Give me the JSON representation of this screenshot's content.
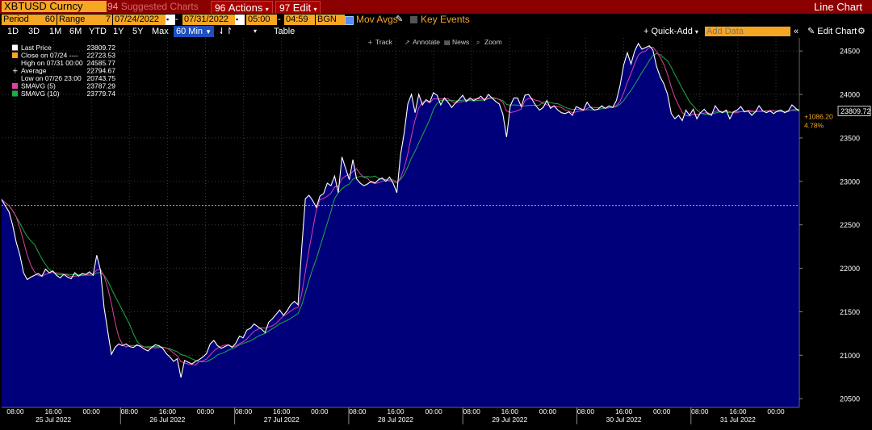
{
  "toolbar": {
    "ticker": "XBTUSD Curncy",
    "suggested_num": "94",
    "suggested": "Suggested Charts",
    "actions_num": "96",
    "actions": "Actions",
    "edit_num": "97",
    "edit": "Edit",
    "title": "Line Chart"
  },
  "settings": {
    "period_label": "Period",
    "period_value": "60",
    "range_label": "Range",
    "range_value": "7",
    "start_date": "07/24/2022",
    "end_date": "07/31/2022",
    "start_time": "05:00",
    "end_time": "04:59",
    "bgn": "BGN",
    "mov_avgs": "Mov Avgs",
    "key_events": "Key Events"
  },
  "ranges": {
    "items": [
      "1D",
      "3D",
      "1M",
      "6M",
      "YTD",
      "1Y",
      "5Y",
      "Max"
    ],
    "selected": "60 Min",
    "table": "Table",
    "quick_add": "Quick-Add",
    "add_data_placeholder": "Add Data",
    "edit_chart": "Edit Chart"
  },
  "tools": {
    "track": "Track",
    "annotate": "Annotate",
    "news": "News",
    "zoom": "Zoom"
  },
  "legend": [
    {
      "label": "Last Price",
      "value": "23809.72",
      "marker": "box",
      "color": "#ffffff"
    },
    {
      "label": "Close on 07/24 ----",
      "value": "22723.53",
      "marker": "box",
      "color": "#f5a623"
    },
    {
      "label": "High on 07/31 00:00",
      "value": "24585.77",
      "marker": "none",
      "color": ""
    },
    {
      "label": "Average",
      "value": "22794.67",
      "marker": "plus",
      "color": "#ffffff"
    },
    {
      "label": "Low on 07/26 23:00",
      "value": "20743.75",
      "marker": "none",
      "color": ""
    },
    {
      "label": "SMAVG (5)",
      "value": "23787.29",
      "marker": "box",
      "color": "#e040a0"
    },
    {
      "label": "SMAVG (10)",
      "value": "23779.74",
      "marker": "box",
      "color": "#22aa44"
    }
  ],
  "right_labels": {
    "last": "23809.72",
    "change": "+1086.20",
    "change_pct": "4.78%"
  },
  "colors": {
    "price": "#ffffff",
    "fill": "#00007a",
    "sma5": "#e040a0",
    "sma10": "#22aa44",
    "reference": "#f5a623",
    "accent": "#f5a623",
    "bar_red": "#8b0000"
  },
  "chart_data": {
    "type": "area",
    "title": "",
    "xlabel": "",
    "ylabel": "",
    "ylim": [
      20400,
      24650
    ],
    "y_ticks": [
      20500,
      21000,
      21500,
      22000,
      22500,
      23000,
      23500,
      24000,
      24500
    ],
    "x_tick_labels": [
      "08:00",
      "16:00",
      "00:00",
      "08:00",
      "16:00",
      "00:00",
      "08:00",
      "16:00",
      "00:00",
      "08:00",
      "16:00",
      "00:00",
      "08:00",
      "16:00",
      "00:00",
      "08:00",
      "16:00",
      "00:00",
      "08:00",
      "16:00",
      "00:00"
    ],
    "x_day_labels": [
      "25 Jul 2022",
      "26 Jul 2022",
      "27 Jul 2022",
      "28 Jul 2022",
      "29 Jul 2022",
      "30 Jul 2022",
      "31 Jul 2022"
    ],
    "reference_value": 22723.53,
    "grid": true,
    "legend_position": "top-left",
    "series": [
      {
        "name": "Last Price",
        "values": [
          22790,
          22720,
          22650,
          22500,
          22300,
          22150,
          21950,
          21870,
          21900,
          21920,
          21940,
          21910,
          21990,
          21950,
          21970,
          21920,
          21890,
          21930,
          21900,
          21880,
          21950,
          21910,
          21940,
          21930,
          21960,
          21920,
          22150,
          21980,
          21550,
          21280,
          21010,
          21090,
          21130,
          21110,
          21130,
          21100,
          21090,
          21120,
          21100,
          21070,
          21050,
          21090,
          21120,
          21110,
          21080,
          21020,
          20980,
          20930,
          20960,
          20744,
          20940,
          20920,
          20900,
          20930,
          20950,
          20980,
          21020,
          21130,
          21170,
          21110,
          21080,
          21100,
          21120,
          21090,
          21140,
          21220,
          21200,
          21290,
          21310,
          21360,
          21330,
          21300,
          21260,
          21380,
          21420,
          21470,
          21520,
          21460,
          21510,
          21580,
          21620,
          21580,
          22220,
          22800,
          22840,
          22780,
          22700,
          22830,
          22860,
          22980,
          22950,
          23060,
          22870,
          23280,
          23150,
          23020,
          23250,
          23030,
          22980,
          22950,
          22970,
          23000,
          22980,
          23020,
          23040,
          23000,
          23050,
          22980,
          22870,
          23300,
          23550,
          23890,
          24000,
          23790,
          24000,
          23880,
          23940,
          23910,
          24020,
          23990,
          23880,
          23960,
          23910,
          23850,
          23900,
          23940,
          23990,
          23920,
          23960,
          23930,
          23950,
          23980,
          23930,
          24000,
          23960,
          23920,
          23890,
          23770,
          23510,
          23870,
          23960,
          23960,
          23860,
          23990,
          24000,
          23940,
          23870,
          23820,
          23850,
          23930,
          23840,
          23870,
          23820,
          23790,
          23780,
          23800,
          23760,
          23860,
          23840,
          23820,
          23910,
          23850,
          23820,
          23830,
          23870,
          23840,
          23870,
          23850,
          23930,
          24100,
          24340,
          24480,
          24350,
          24500,
          24586,
          24520,
          24540,
          24560,
          24510,
          24320,
          24200,
          24120,
          24000,
          23780,
          23720,
          23760,
          23700,
          23820,
          23760,
          23830,
          23720,
          23790,
          23830,
          23780,
          23760,
          23870,
          23810,
          23790,
          23820,
          23720,
          23800,
          23820,
          23860,
          23800,
          23810,
          23760,
          23800,
          23870,
          23810,
          23790,
          23810,
          23780,
          23810,
          23820,
          23790,
          23810,
          23880,
          23840,
          23810
        ]
      }
    ]
  }
}
